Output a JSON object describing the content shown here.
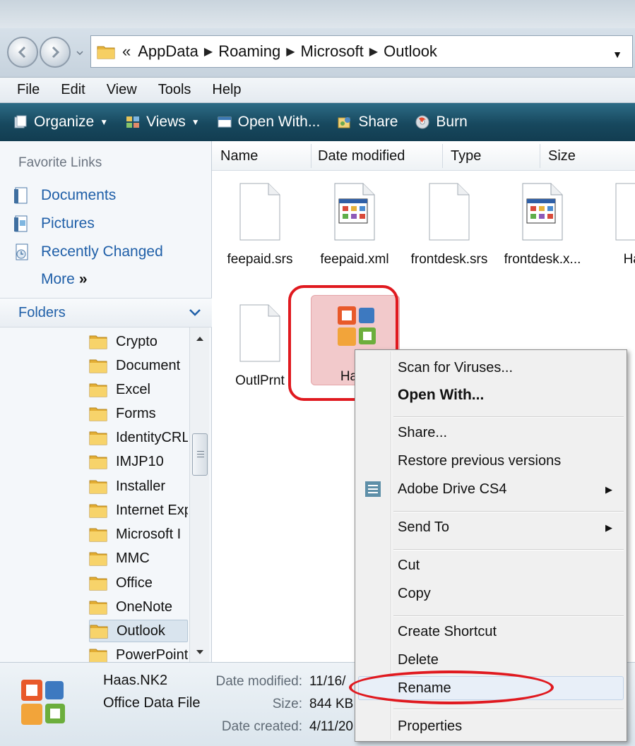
{
  "address": {
    "lead": "«",
    "crumbs": [
      "AppData",
      "Roaming",
      "Microsoft",
      "Outlook"
    ]
  },
  "menu": [
    "File",
    "Edit",
    "View",
    "Tools",
    "Help"
  ],
  "toolbar": {
    "organize": "Organize",
    "views": "Views",
    "open_with": "Open With...",
    "share": "Share",
    "burn": "Burn"
  },
  "favorites": {
    "header": "Favorite Links",
    "links": [
      "Documents",
      "Pictures",
      "Recently Changed"
    ],
    "more": "More",
    "more_glyph": "»"
  },
  "folders": {
    "header": "Folders",
    "items": [
      "Crypto",
      "Document",
      "Excel",
      "Forms",
      "IdentityCRL",
      "IMJP10",
      "Installer",
      "Internet Exp",
      "Microsoft I",
      "MMC",
      "Office",
      "OneNote",
      "Outlook",
      "PowerPoint"
    ],
    "selected": "Outlook"
  },
  "columns": [
    "Name",
    "Date modified",
    "Type",
    "Size"
  ],
  "files": [
    {
      "name": "feepaid.srs",
      "icon": "blank-file-icon"
    },
    {
      "name": "feepaid.xml",
      "icon": "xml-file-icon"
    },
    {
      "name": "frontdesk.srs",
      "icon": "blank-file-icon"
    },
    {
      "name": "frontdesk.x...",
      "icon": "xml-file-icon"
    },
    {
      "name": "Haa",
      "icon": "blank-file-icon"
    },
    {
      "name": "OutlPrnt",
      "icon": "blank-file-icon"
    },
    {
      "name": "Haas",
      "icon": "office-file-icon"
    }
  ],
  "context_menu": {
    "items": [
      "Scan for Viruses...",
      "Open With...",
      "Share...",
      "Restore previous versions",
      "Adobe Drive CS4",
      "Send To",
      "Cut",
      "Copy",
      "Create Shortcut",
      "Delete",
      "Rename",
      "Properties"
    ],
    "highlighted": "Rename"
  },
  "details": {
    "name": "Haas.NK2",
    "type": "Office Data File",
    "modified_label": "Date modified:",
    "modified_value": "11/16/",
    "size_label": "Size:",
    "size_value": "844 KB",
    "created_label": "Date created:",
    "created_value": "4/11/20"
  },
  "colors": {
    "link": "#1f5fa8",
    "toolbar": "#17485e",
    "annotation": "#e0191f",
    "selection": "#f2c9cb"
  }
}
